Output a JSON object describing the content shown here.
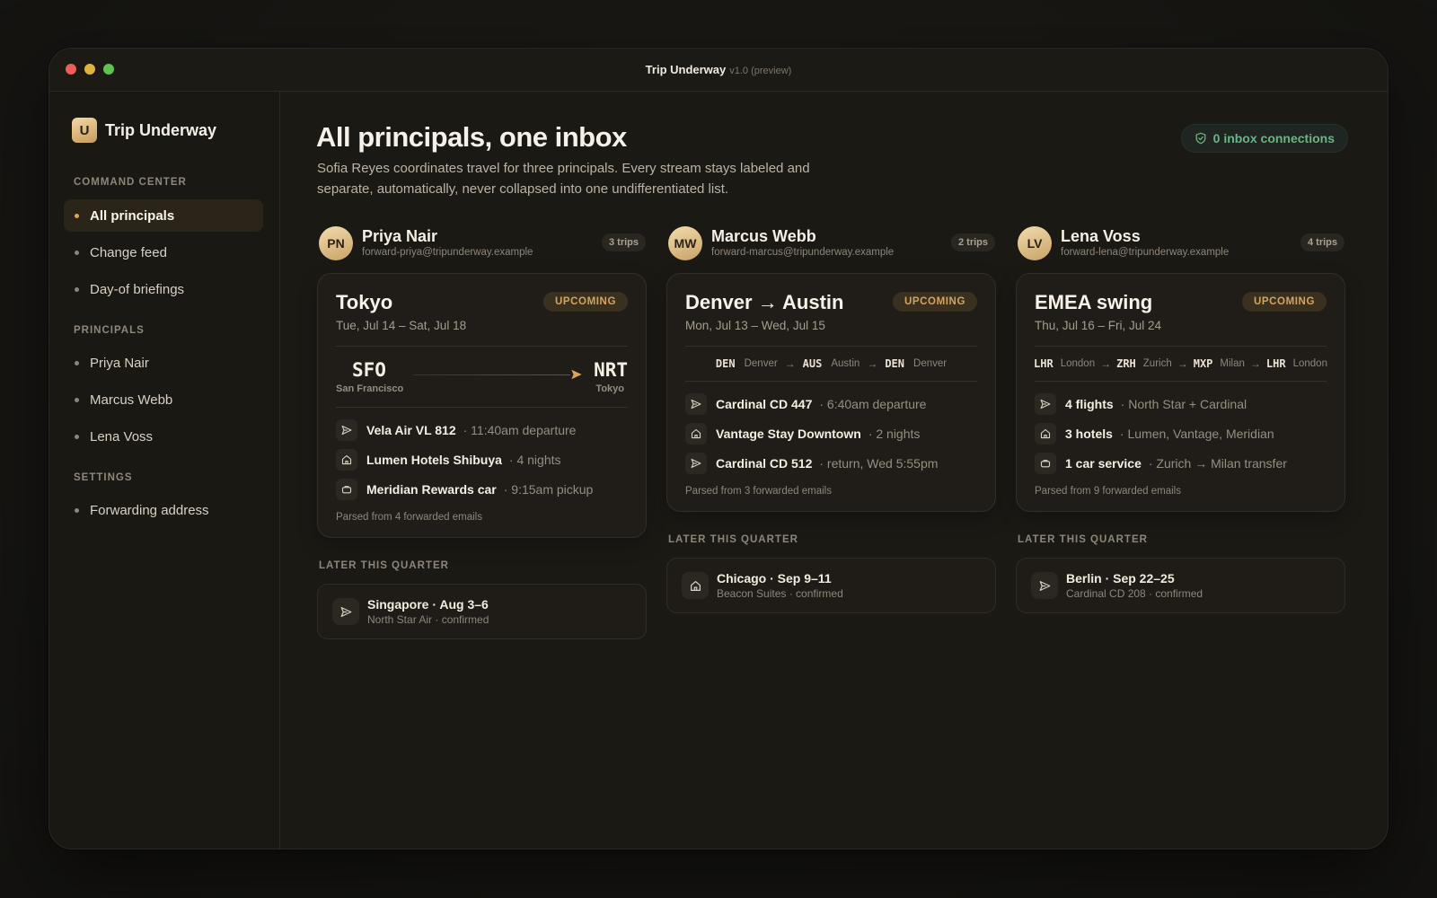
{
  "window": {
    "title": "Trip Underway",
    "version": "v1.0 (preview)"
  },
  "sidebar": {
    "logo_letter": "U",
    "app_name": "Trip Underway",
    "sections": [
      {
        "label": "COMMAND CENTER",
        "items": [
          {
            "label": "All principals",
            "active": true
          },
          {
            "label": "Change feed"
          },
          {
            "label": "Day-of briefings"
          }
        ]
      },
      {
        "label": "PRINCIPALS",
        "items": [
          {
            "label": "Priya Nair"
          },
          {
            "label": "Marcus Webb"
          },
          {
            "label": "Lena Voss"
          }
        ]
      },
      {
        "label": "SETTINGS",
        "items": [
          {
            "label": "Forwarding address"
          }
        ]
      }
    ]
  },
  "main": {
    "title": "All principals, one inbox",
    "subtitle": "Sofia Reyes coordinates travel for three principals. Every stream stays labeled and separate, automatically, never collapsed into one undifferentiated list.",
    "connections": "0 inbox connections",
    "later_label": "LATER THIS QUARTER",
    "principals": [
      {
        "initials": "PN",
        "name": "Priya Nair",
        "email": "forward-priya@tripunderway.example",
        "trips": "3 trips",
        "card": {
          "destination": "Tokyo",
          "dates": "Tue, Jul 14 – Sat, Jul 18",
          "status": "UPCOMING",
          "route": {
            "from_code": "SFO",
            "from_city": "San Francisco",
            "to_code": "NRT",
            "to_city": "Tokyo"
          },
          "items": [
            {
              "icon": "plane-icon",
              "main": "Vela Air VL 812",
              "detail": "· 11:40am departure"
            },
            {
              "icon": "hotel-icon",
              "main": "Lumen Hotels Shibuya",
              "detail": "· 4 nights"
            },
            {
              "icon": "car-icon",
              "main": "Meridian Rewards car",
              "detail": "· 9:15am pickup"
            }
          ],
          "parsed": "Parsed from 4 forwarded emails"
        },
        "later": {
          "icon": "plane-icon",
          "title": "Singapore · Aug 3–6",
          "sub": "North Star Air · confirmed"
        }
      },
      {
        "initials": "MW",
        "name": "Marcus Webb",
        "email": "forward-marcus@tripunderway.example",
        "trips": "2 trips",
        "card": {
          "destination": "Denver → Austin",
          "dates": "Mon, Jul 13 – Wed, Jul 15",
          "status": "UPCOMING",
          "chain": [
            {
              "code": "DEN",
              "city": "Denver"
            },
            {
              "code": "AUS",
              "city": "Austin"
            },
            {
              "code": "DEN",
              "city": "Denver"
            }
          ],
          "items": [
            {
              "icon": "plane-icon",
              "main": "Cardinal CD 447",
              "detail": "· 6:40am departure"
            },
            {
              "icon": "hotel-icon",
              "main": "Vantage Stay Downtown",
              "detail": "· 2 nights"
            },
            {
              "icon": "plane-icon",
              "main": "Cardinal CD 512",
              "detail": "· return, Wed 5:55pm"
            }
          ],
          "parsed": "Parsed from 3 forwarded emails"
        },
        "later": {
          "icon": "hotel-icon",
          "title": "Chicago · Sep 9–11",
          "sub": "Beacon Suites · confirmed"
        }
      },
      {
        "initials": "LV",
        "name": "Lena Voss",
        "email": "forward-lena@tripunderway.example",
        "trips": "4 trips",
        "card": {
          "destination": "EMEA swing",
          "dates": "Thu, Jul 16 – Fri, Jul 24",
          "status": "UPCOMING",
          "chain": [
            {
              "code": "LHR",
              "city": "London"
            },
            {
              "code": "ZRH",
              "city": "Zurich"
            },
            {
              "code": "MXP",
              "city": "Milan"
            },
            {
              "code": "LHR",
              "city": "London"
            }
          ],
          "items": [
            {
              "icon": "plane-icon",
              "main": "4 flights",
              "detail": "· North Star + Cardinal"
            },
            {
              "icon": "hotel-icon",
              "main": "3 hotels",
              "detail": "· Lumen, Vantage, Meridian"
            },
            {
              "icon": "car-icon",
              "main": "1 car service",
              "detail": "· Zurich → Milan transfer"
            }
          ],
          "parsed": "Parsed from 9 forwarded emails"
        },
        "later": {
          "icon": "plane-icon",
          "title": "Berlin · Sep 22–25",
          "sub": "Cardinal CD 208 · confirmed"
        }
      }
    ]
  },
  "colors": {
    "accent": "#d7a65c",
    "success": "#6fb186",
    "background": "#1b1914"
  }
}
